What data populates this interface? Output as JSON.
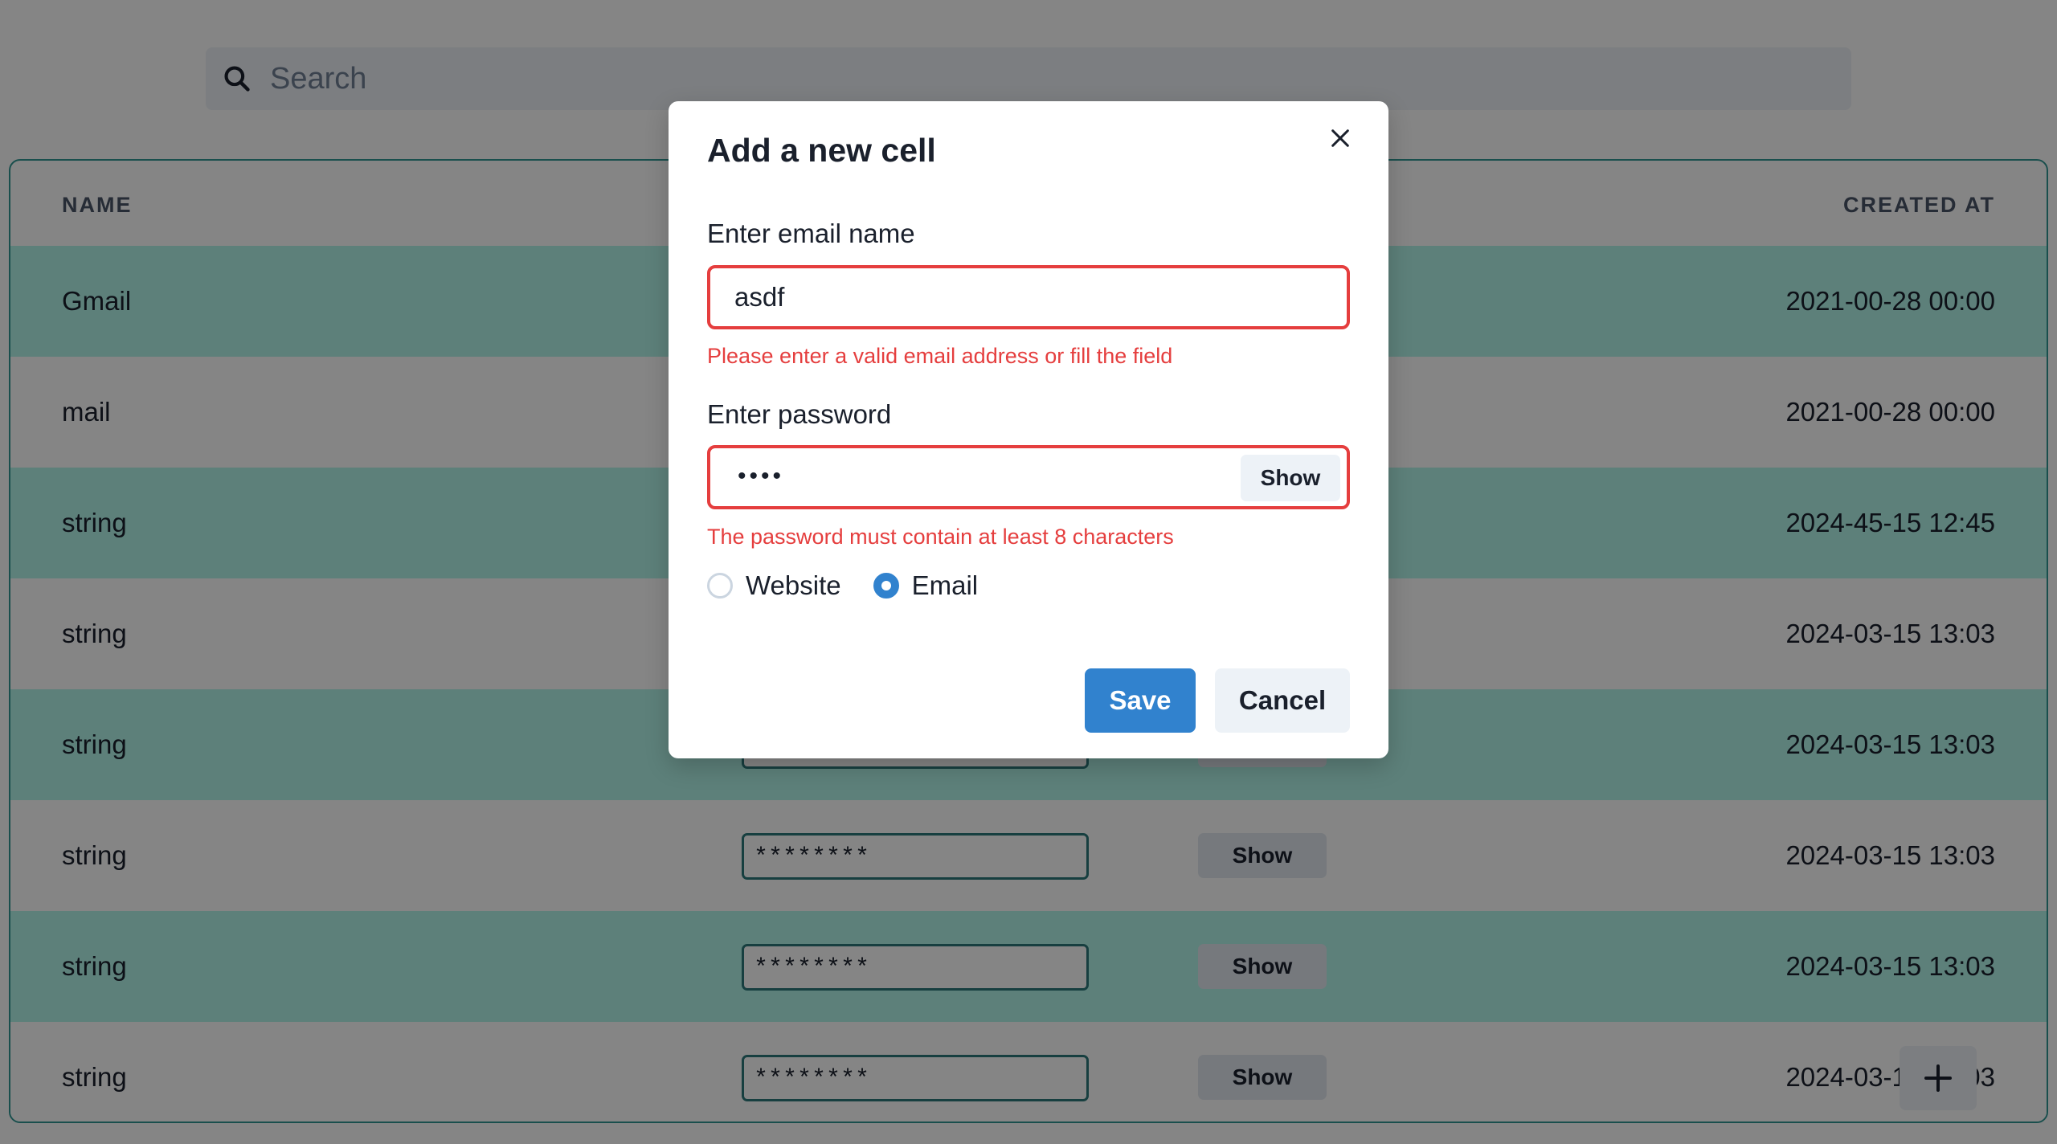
{
  "search": {
    "placeholder": "Search"
  },
  "table": {
    "headers": {
      "name": "NAME",
      "created_at": "CREATED AT"
    },
    "show_label": "Show",
    "rows": [
      {
        "name": "Gmail",
        "password": "********",
        "created_at": "2021-00-28 00:00"
      },
      {
        "name": "mail",
        "password": "********",
        "created_at": "2021-00-28 00:00"
      },
      {
        "name": "string",
        "password": "********",
        "created_at": "2024-45-15 12:45"
      },
      {
        "name": "string",
        "password": "********",
        "created_at": "2024-03-15 13:03"
      },
      {
        "name": "string",
        "password": "********",
        "created_at": "2024-03-15 13:03"
      },
      {
        "name": "string",
        "password": "********",
        "created_at": "2024-03-15 13:03"
      },
      {
        "name": "string",
        "password": "********",
        "created_at": "2024-03-15 13:03"
      },
      {
        "name": "string",
        "password": "********",
        "created_at": "2024-03-15 13:03"
      }
    ]
  },
  "modal": {
    "title": "Add a new cell",
    "email_label": "Enter email name",
    "email_value": "asdf",
    "email_error": "Please enter a valid email address or fill the field",
    "password_label": "Enter password",
    "password_masked": "••••",
    "password_show": "Show",
    "password_error": "The password must contain at least 8 characters",
    "type_options": [
      "Website",
      "Email"
    ],
    "type_selected": "Email",
    "save_label": "Save",
    "cancel_label": "Cancel"
  },
  "colors": {
    "accent": "#3182ce",
    "error": "#e53e3e",
    "row_highlight": "#b2f5ea",
    "border_teal": "#319795"
  },
  "icons": {
    "search": "search-icon",
    "close": "close-icon",
    "add": "plus-icon"
  }
}
